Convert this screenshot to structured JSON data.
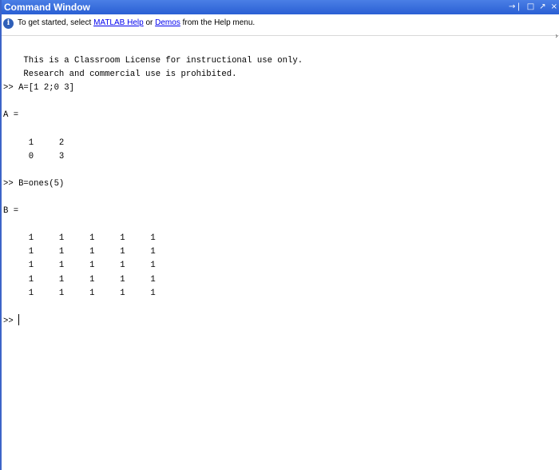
{
  "window": {
    "title": "Command Window",
    "controls": {
      "undock": "→❘",
      "maximize": "□",
      "restore": "↗",
      "close": "×"
    }
  },
  "infobar": {
    "prefix": "To get started, select ",
    "link1": "MATLAB Help",
    "middle": " or ",
    "link2": "Demos",
    "suffix": " from the Help menu.",
    "edge_mark": "›"
  },
  "console": {
    "lines": [
      "    This is a Classroom License for instructional use only.",
      "    Research and commercial use is prohibited.",
      ">> A=[1 2;0 3]",
      "",
      "A =",
      "",
      "     1     2",
      "     0     3",
      "",
      ">> B=ones(5)",
      "",
      "B =",
      "",
      "     1     1     1     1     1",
      "     1     1     1     1     1",
      "     1     1     1     1     1",
      "     1     1     1     1     1",
      "     1     1     1     1     1",
      "",
      ">> "
    ]
  }
}
